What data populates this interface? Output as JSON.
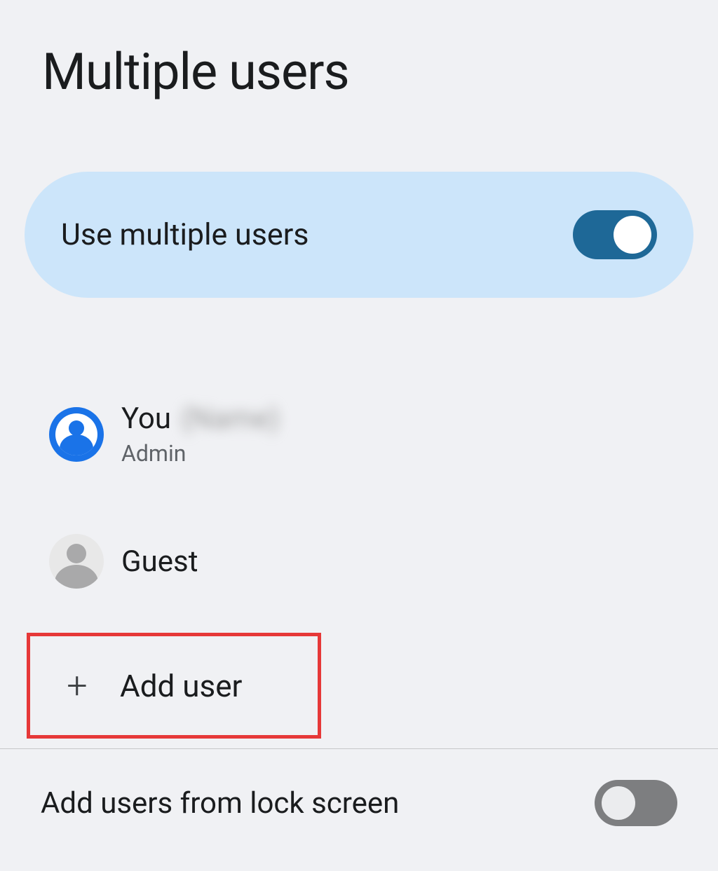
{
  "page": {
    "title": "Multiple users"
  },
  "toggleCard": {
    "label": "Use multiple users",
    "on": true
  },
  "users": [
    {
      "name": "You",
      "extra": "(Name)",
      "role": "Admin",
      "avatar": "blue"
    },
    {
      "name": "Guest",
      "avatar": "gray"
    }
  ],
  "addUser": {
    "label": "Add user"
  },
  "bottom": {
    "label": "Add users from lock screen",
    "on": false
  },
  "colors": {
    "accent": "#1e6897",
    "cardBg": "#cce5fa",
    "highlightBorder": "#e63838"
  }
}
